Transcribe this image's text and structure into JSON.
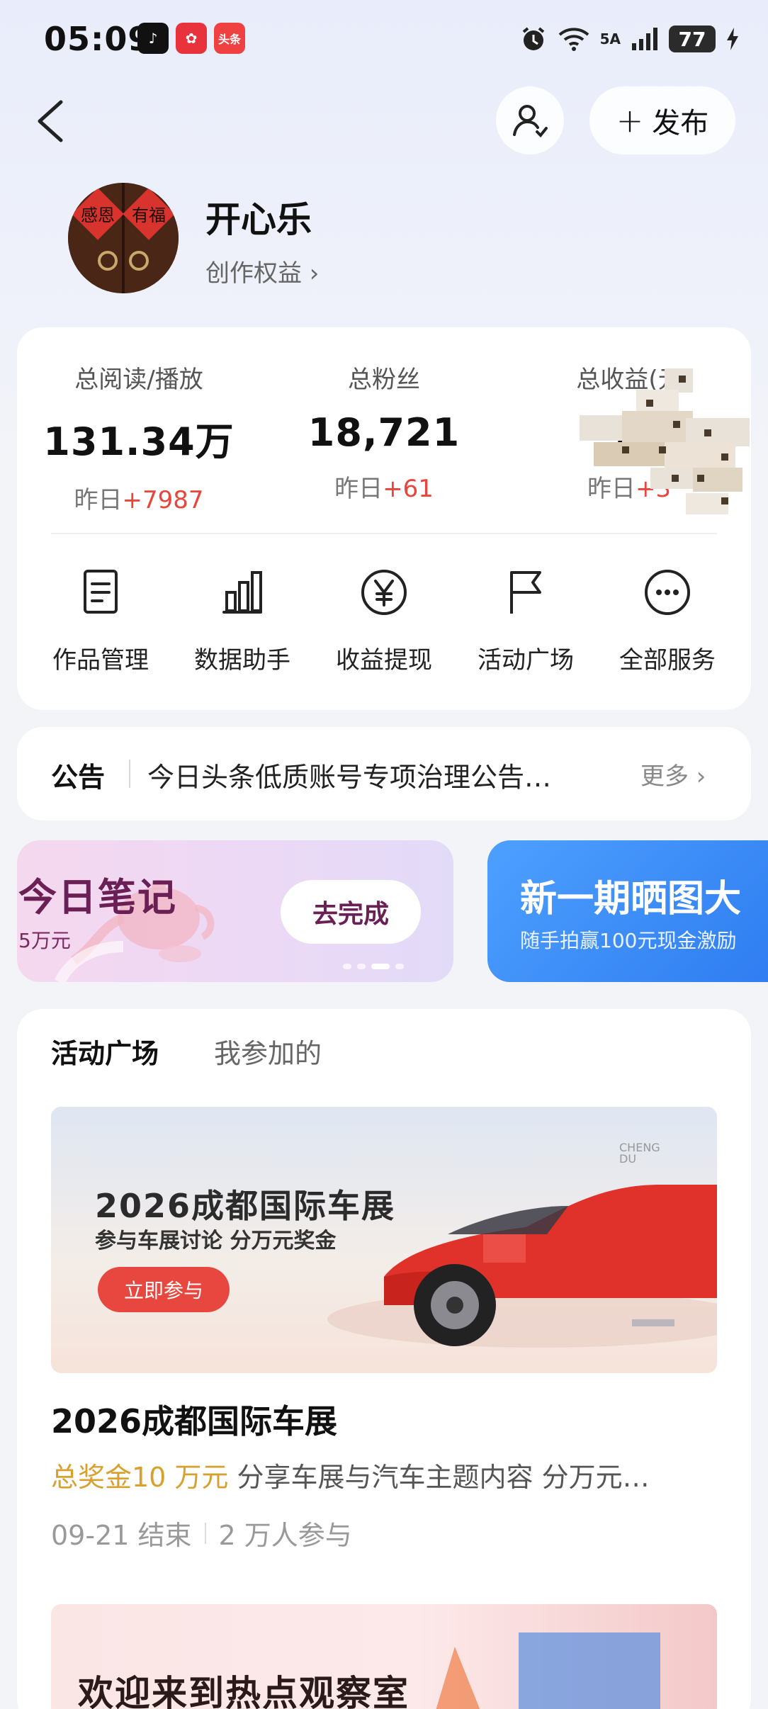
{
  "status_bar": {
    "time": "05:09",
    "apps": [
      {
        "name": "tiktok-icon",
        "glyph": "♪",
        "color": "#111111"
      },
      {
        "name": "app-icon-red",
        "glyph": "✿",
        "color": "#e8323c"
      },
      {
        "name": "toutiao-icon",
        "glyph": "头条",
        "color": "#f04142"
      }
    ],
    "network": "5A",
    "battery": "77"
  },
  "header": {
    "publish_label": "发布"
  },
  "profile": {
    "name": "开心乐",
    "rights_label": "创作权益 ›"
  },
  "stats": [
    {
      "label": "总阅读/播放",
      "value": "131.34万",
      "delta_prefix": "昨日",
      "delta": "+7987"
    },
    {
      "label": "总粉丝",
      "value": "18,721",
      "delta_prefix": "昨日",
      "delta": "+61"
    },
    {
      "label": "总收益(元",
      "value": "3",
      "delta_prefix": "昨日",
      "delta": "+3"
    }
  ],
  "services": [
    {
      "label": "作品管理",
      "icon": "document-icon"
    },
    {
      "label": "数据助手",
      "icon": "bar-chart-icon"
    },
    {
      "label": "收益提现",
      "icon": "yuan-icon"
    },
    {
      "label": "活动广场",
      "icon": "flag-icon"
    },
    {
      "label": "全部服务",
      "icon": "more-icon"
    }
  ],
  "notice": {
    "tag": "公告",
    "text": "今日头条低质账号专项治理公告…",
    "more": "更多 ›"
  },
  "banners": {
    "left": {
      "title": "今日笔记",
      "subtitle": "5万元",
      "button": "去完成"
    },
    "right": {
      "title": "新一期晒图大",
      "subtitle": "随手拍赢100元现金激励"
    }
  },
  "activity": {
    "tab_active": "活动广场",
    "tab_other": "我参加的",
    "promo": {
      "title": "2026成都国际车展",
      "subtitle": "参与车展讨论 分万元奖金",
      "button": "立即参与",
      "logo_top": "CHENG",
      "logo_bottom": "DU"
    },
    "title": "2026成都国际车展",
    "prize": "总奖金10 万元",
    "desc": " 分享车展与汽车主题内容 分万元…",
    "end_date": "09-21 结束",
    "participants": "2 万人参与",
    "next_title": "欢迎来到热点观察室"
  }
}
